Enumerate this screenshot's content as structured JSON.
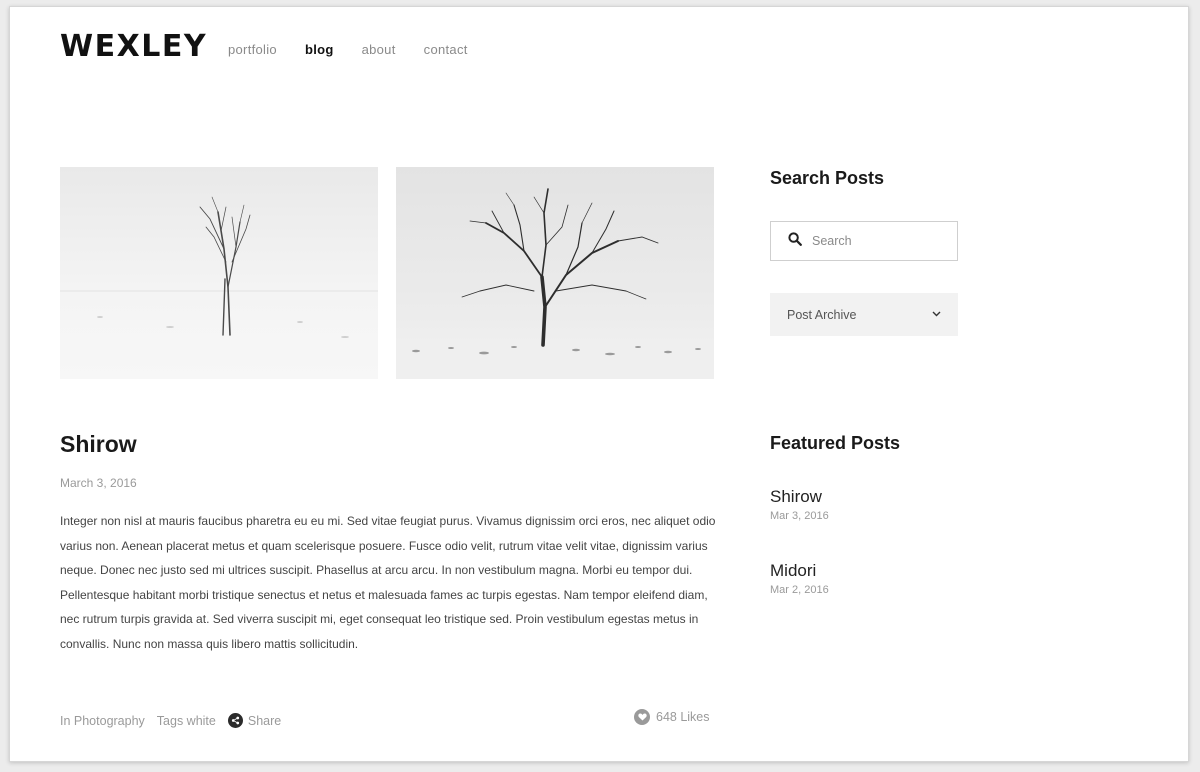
{
  "header": {
    "logo": "WEXLEY",
    "nav": [
      {
        "label": "portfolio"
      },
      {
        "label": "blog"
      },
      {
        "label": "about"
      },
      {
        "label": "contact"
      }
    ]
  },
  "post": {
    "title": "Shirow",
    "date": "March 3, 2016",
    "body": "Integer non nisl at mauris faucibus pharetra eu eu mi. Sed vitae feugiat purus. Vivamus dignissim orci eros, nec aliquet odio varius non. Aenean placerat metus et quam scelerisque posuere. Fusce odio velit, rutrum vitae velit vitae, dignissim varius neque. Donec nec justo sed mi ultrices suscipit. Phasellus at arcu arcu. In non vestibulum magna. Morbi eu tempor dui. Pellentesque habitant morbi tristique senectus et netus et malesuada fames ac turpis egestas. Nam tempor eleifend diam, nec rutrum turpis gravida at. Sed viverra suscipit mi, eget consequat leo tristique sed. Proin vestibulum egestas metus in convallis. Nunc non massa quis libero mattis sollicitudin.",
    "category": "In Photography",
    "tags": "Tags white",
    "share_label": "Share",
    "likes": "648 Likes"
  },
  "sidebar": {
    "search_heading": "Search Posts",
    "search_placeholder": "Search",
    "archive_label": "Post Archive",
    "featured_heading": "Featured Posts",
    "featured": [
      {
        "title": "Shirow",
        "date": "Mar 3, 2016"
      },
      {
        "title": "Midori",
        "date": "Mar 2, 2016"
      }
    ]
  },
  "icons": {
    "search": "search-icon",
    "chevron": "chevron-down-icon",
    "share": "share-icon",
    "heart": "heart-icon"
  }
}
